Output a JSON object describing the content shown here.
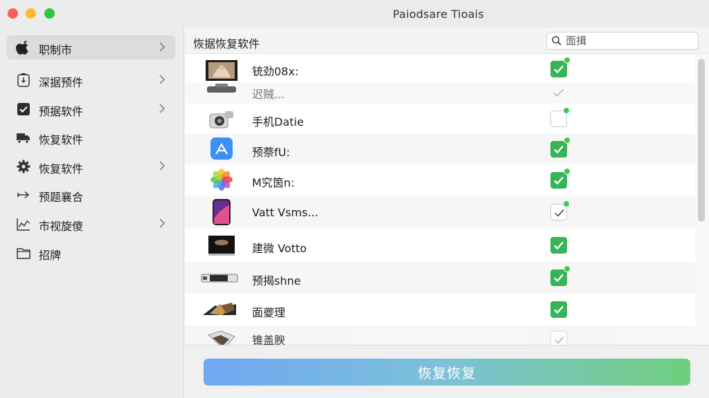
{
  "window": {
    "title": "Paiodsare Tioais"
  },
  "sidebar": {
    "items": [
      {
        "label": "职制市",
        "icon": "apple-icon",
        "chevron": true,
        "selected": true
      },
      {
        "label": "深据预件",
        "icon": "phone-sync-icon",
        "chevron": true
      },
      {
        "label": "预据软件",
        "icon": "checkbox-icon",
        "chevron": true
      },
      {
        "label": "恢复软件",
        "icon": "truck-icon",
        "chevron": false
      },
      {
        "label": "恢复软件",
        "icon": "gear-icon",
        "chevron": true
      },
      {
        "label": "预题襄合",
        "icon": "arrow-right-icon",
        "chevron": false
      },
      {
        "label": "市视旋傻",
        "icon": "chart-line-icon",
        "chevron": true
      },
      {
        "label": "招牌",
        "icon": "folder-icon",
        "chevron": false
      }
    ]
  },
  "main": {
    "title": "恢据恢复软件",
    "search": {
      "placeholder": "面揖"
    },
    "rows": [
      {
        "label": "铳劲08x:",
        "checked": true,
        "dot": true,
        "thumb": "photo-hands"
      },
      {
        "label": "迟贼...",
        "checked": false,
        "dot": false,
        "faded": true,
        "thumb": "device-dark"
      },
      {
        "label": "手机Datie",
        "checked": false,
        "dot": true,
        "thumb": "camera"
      },
      {
        "label": "预萘fU:",
        "checked": true,
        "dot": true,
        "thumb": "app-store-icon"
      },
      {
        "label": "M究筃n:",
        "checked": true,
        "dot": true,
        "thumb": "photos-icon"
      },
      {
        "label": "Vatt Vsms...",
        "checked": false,
        "dot": true,
        "thumb": "phone-screen"
      },
      {
        "label": "建微 Votto",
        "checked": true,
        "dot": false,
        "thumb": "video-screen"
      },
      {
        "label": "预揭shne",
        "checked": true,
        "dot": true,
        "thumb": "device-bar"
      },
      {
        "label": "面夔理",
        "checked": true,
        "dot": false,
        "thumb": "photo-stack"
      },
      {
        "label": "锥盖腴",
        "checked": false,
        "dot": false,
        "faded": true,
        "thumb": "photo-folded"
      }
    ]
  },
  "footer": {
    "button_label": "恢复恢复"
  },
  "colors": {
    "check_green": "#35b45a",
    "button_gradient_start": "#6ea8f2",
    "button_gradient_end": "#6fcf7d"
  }
}
